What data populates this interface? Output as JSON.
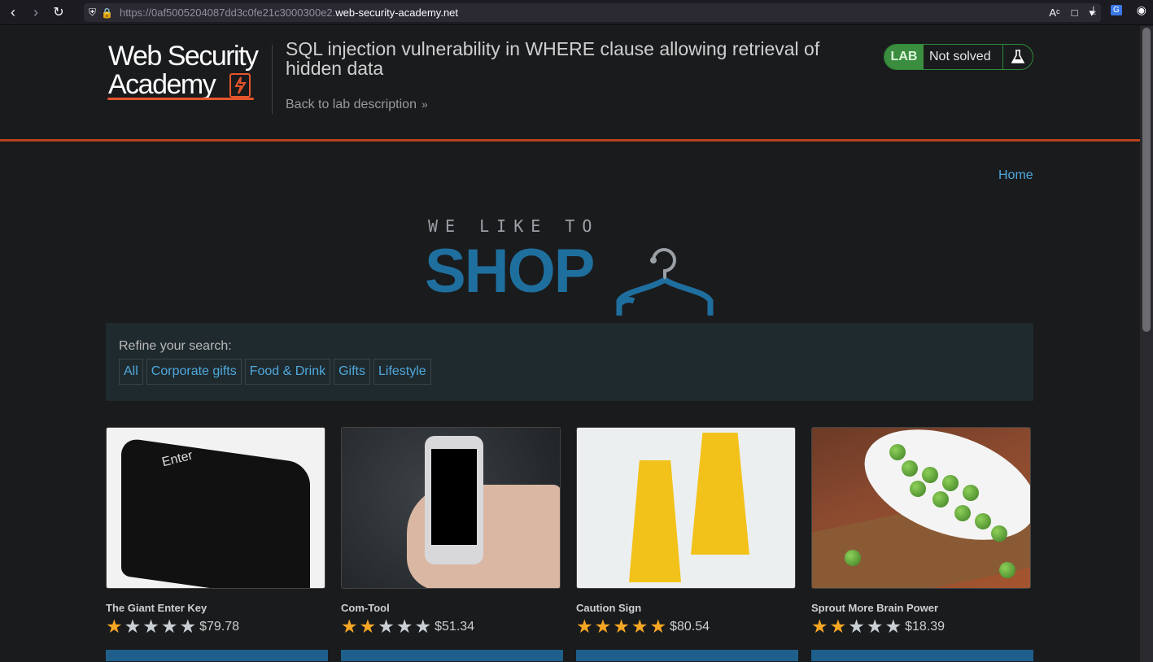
{
  "browser": {
    "url_prefix": "https://0af5005204087dd3c0fe21c3000300e2.",
    "url_domain": "web-security-academy.net",
    "back_icon": "chevron-left-icon",
    "forward_icon": "chevron-right-icon",
    "reload_icon": "reload-icon"
  },
  "header": {
    "logo_line1": "Web Security",
    "logo_line2": "Academy",
    "lab_title": "SQL injection vulnerability in WHERE clause allowing retrieval of hidden data",
    "back_link": "Back to lab description",
    "lab_badge": "LAB",
    "lab_status": "Not solved",
    "accent_color": "#b8421c"
  },
  "shop": {
    "home_link": "Home",
    "tagline": "WE LIKE TO",
    "wordmark": "SHOP",
    "refine_label": "Refine your search:",
    "categories": [
      "All",
      "Corporate gifts",
      "Food & Drink",
      "Gifts",
      "Lifestyle"
    ]
  },
  "products": [
    {
      "name": "The Giant Enter Key",
      "rating": 1,
      "price": "$79.78"
    },
    {
      "name": "Com-Tool",
      "rating": 2,
      "price": "$51.34"
    },
    {
      "name": "Caution Sign",
      "rating": 5,
      "price": "$80.54"
    },
    {
      "name": "Sprout More Brain Power",
      "rating": 2,
      "price": "$18.39"
    }
  ],
  "key_image_label": "Enter"
}
